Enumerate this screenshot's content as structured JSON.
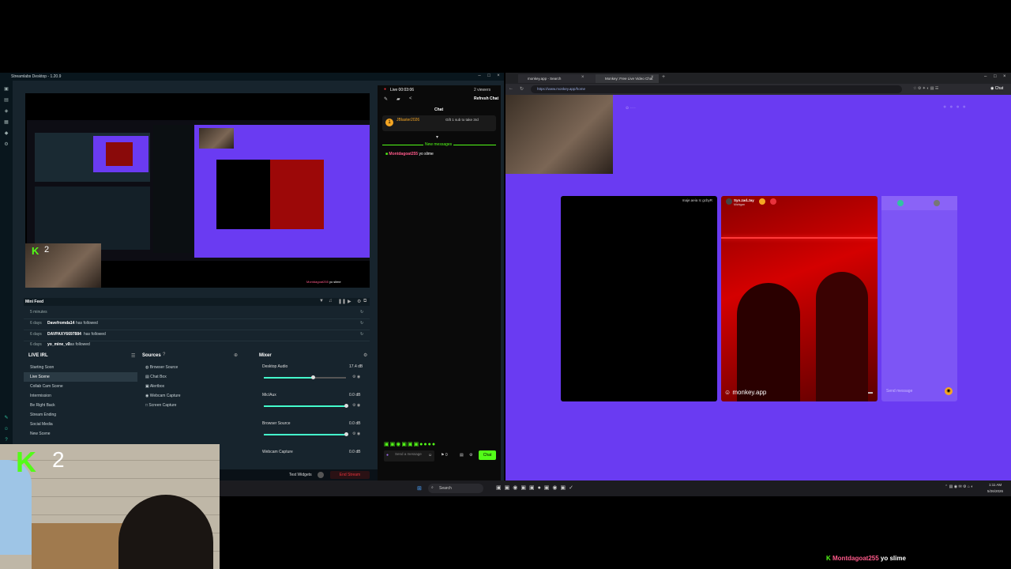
{
  "streamlabs": {
    "title": "Streamlabs Desktop - 1.20.9",
    "minifeed": {
      "title": "Mini Feed",
      "rows": [
        {
          "time": "5 minutes",
          "user": "",
          "action": ""
        },
        {
          "time": "6 days",
          "user": "Davefromda14",
          "action": "has followed"
        },
        {
          "time": "6 days",
          "user": "DAVPAXY6697884",
          "action": "has followed"
        },
        {
          "time": "6 days",
          "user": "yo_mine_v2",
          "action": "has followed"
        }
      ]
    },
    "scenes": {
      "title": "LIVE IRL",
      "items": [
        "Starting Soon",
        "Live Scene",
        "Collab Cam Scene",
        "Intermission",
        "Be Right Back",
        "Stream Ending",
        "Social Media",
        "New Scene"
      ],
      "selected_index": 1
    },
    "sources": {
      "title": "Sources",
      "items": [
        "Browser Source",
        "Chat Box",
        "Alertbox",
        "Webcam Capture",
        "Screen Capture"
      ]
    },
    "mixer": {
      "title": "Mixer",
      "channels": [
        {
          "name": "Desktop Audio",
          "db": "17.4 dB",
          "level": 0.6
        },
        {
          "name": "Mic/Aux",
          "db": "0.0 dB",
          "level": 1.0
        },
        {
          "name": "Browser Source",
          "db": "0.0 dB",
          "level": 1.0
        },
        {
          "name": "Webcam Capture",
          "db": "0.0 dB",
          "level": 1.0
        }
      ]
    },
    "chat": {
      "live_time": "Live 00:03:06",
      "viewers": "2 viewers",
      "title": "Chat",
      "refresh": "Refresh Chat",
      "alert_user": "JBlaster2026",
      "alert_msg": "Gift 1 sub to take 3rd",
      "new_messages": "New messages",
      "message_user": "Montdagoat255",
      "message_text": "yo slime",
      "input_placeholder": "Send a message",
      "chat_button": "Chat"
    },
    "preview_overlay_count": "2",
    "test_widgets": "Test Widgets",
    "end_stream": "End Stream",
    "preview_chat_user": "Montdagoat255",
    "preview_chat_text": "yo slime"
  },
  "browser": {
    "tabs": [
      {
        "label": "monkey.app - Search",
        "active": false
      },
      {
        "label": "Monkey: Free Live Video Chat",
        "active": true
      }
    ],
    "url": "https://www.monkey.app/home",
    "tile1_caption": "maje.aeia Ic gcbyR",
    "tile2_user": "Syn.zad.Jay",
    "tile2_sub": "Michigan",
    "watermark": "monkey.app",
    "send_placeholder": "Send message"
  },
  "taskbar": {
    "search_label": "Search",
    "time": "1:11 AM",
    "date": "5/26/2026"
  },
  "overlay": {
    "kick_count": "2",
    "chat_user": "Montdagoat255",
    "chat_text": "yo slime"
  },
  "colors": {
    "kick_green": "#53fc18",
    "monkey_purple": "#6a3bf2",
    "streamlabs_teal": "#31c3a2",
    "chat_username": "#ff5a8a",
    "end_stream_red": "#e8323c"
  }
}
